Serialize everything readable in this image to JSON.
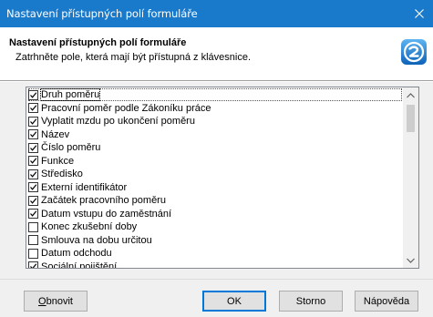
{
  "window": {
    "title": "Nastavení přístupných polí formuláře",
    "accent": "#1979ca"
  },
  "header": {
    "title": "Nastavení přístupných polí formuláře",
    "subtitle": "Zatrhněte pole, která mají být přístupná z klávesnice.",
    "logo_icon": "app-logo-icon"
  },
  "fields": {
    "items": [
      {
        "label": "Druh poměru",
        "checked": true,
        "focused": true
      },
      {
        "label": "Pracovní poměr podle Zákoníku práce",
        "checked": true
      },
      {
        "label": "Vyplatit mzdu po ukončení poměru",
        "checked": true
      },
      {
        "label": "Název",
        "checked": true
      },
      {
        "label": "Číslo poměru",
        "checked": true
      },
      {
        "label": "Funkce",
        "checked": true
      },
      {
        "label": "Středisko",
        "checked": true
      },
      {
        "label": "Externí identifikátor",
        "checked": true
      },
      {
        "label": "Začátek pracovního poměru",
        "checked": true
      },
      {
        "label": "Datum vstupu do zaměstnání",
        "checked": true
      },
      {
        "label": "Konec zkušební doby",
        "checked": false
      },
      {
        "label": "Smlouva na dobu určitou",
        "checked": false
      },
      {
        "label": "Datum odchodu",
        "checked": false
      },
      {
        "label": "Sociální pojištění",
        "checked": true
      }
    ]
  },
  "buttons": {
    "refresh_underline": "O",
    "refresh_rest": "bnovit",
    "ok": "OK",
    "cancel": "Storno",
    "help": "Nápověda"
  }
}
